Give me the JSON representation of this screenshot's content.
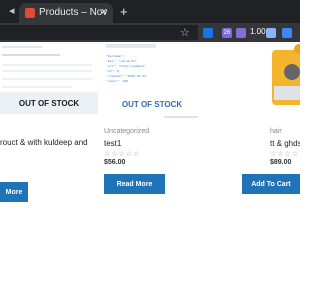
{
  "browser": {
    "tab_title": "Products – Nov",
    "close_glyph": "×",
    "newtab_glyph": "+",
    "star_glyph": "☆",
    "ext_badge": "26",
    "ext_value": "1.00",
    "tab_arrow": "◂"
  },
  "products": [
    {
      "category": "",
      "name": "rouct & with kuldeep and",
      "stars": "",
      "price": "",
      "badge": "OUT OF STOCK",
      "button": "More"
    },
    {
      "category": "Uncategorized",
      "name": "test1",
      "stars": "☆☆☆☆☆",
      "price": "$56.00",
      "badge": "OUT OF STOCK",
      "button": "Read More"
    },
    {
      "category": "hair",
      "name": "tt & ghdsfsd",
      "stars": "☆☆☆☆☆",
      "price": "$89.00",
      "badge": "",
      "button": "Add To Cart"
    }
  ],
  "colors": {
    "button": "#1f73b7",
    "oos_blue": "#2f6db3",
    "chrome_dark": "#202124"
  }
}
